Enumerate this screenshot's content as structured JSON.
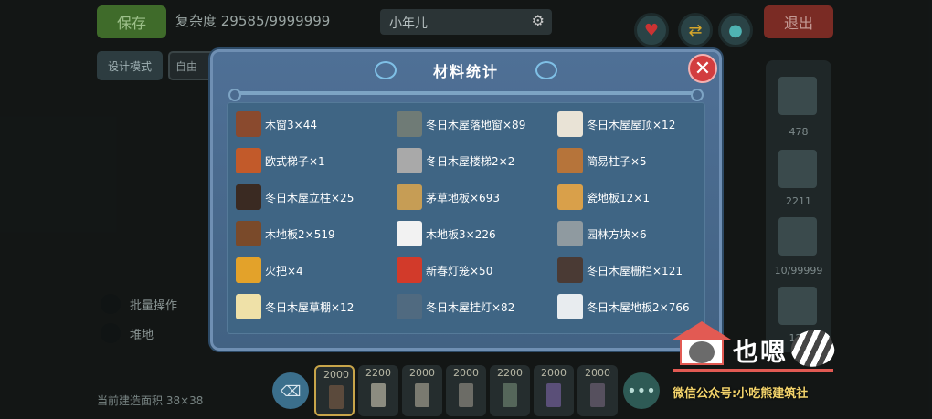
{
  "hud": {
    "save_label": "保存",
    "complexity": "复杂度 29585/9999999",
    "build_name": "小年儿",
    "exit_label": "退出",
    "design_mode": "设计模式",
    "free_cam": "自由",
    "batch_label": "批量操作",
    "flat_label": "堆地",
    "area_label": "当前建造面积 38×38",
    "side_counts": [
      "478",
      "2211",
      "10/99999",
      "121"
    ],
    "hotbar_costs": [
      "2000",
      "2200",
      "2000",
      "2000",
      "2200",
      "2000",
      "2000"
    ]
  },
  "dialog": {
    "title": "材料统计",
    "close_icon": "close-icon",
    "items": [
      {
        "label": "木窗3×44",
        "icon": "window-icon",
        "color": "#8a4a2e"
      },
      {
        "label": "冬日木屋落地窗×89",
        "icon": "floor-window-icon",
        "color": "#6f7b76"
      },
      {
        "label": "冬日木屋屋顶×12",
        "icon": "roof-icon",
        "color": "#e9e3d6"
      },
      {
        "label": "欧式梯子×1",
        "icon": "ladder-icon",
        "color": "#c25a2a"
      },
      {
        "label": "冬日木屋楼梯2×2",
        "icon": "stairs-icon",
        "color": "#a9a9a9"
      },
      {
        "label": "简易柱子×5",
        "icon": "pillar-icon",
        "color": "#b6743a"
      },
      {
        "label": "冬日木屋立柱×25",
        "icon": "post-icon",
        "color": "#3a2a22"
      },
      {
        "label": "茅草地板×693",
        "icon": "thatch-floor-icon",
        "color": "#c69d55"
      },
      {
        "label": "瓷地板12×1",
        "icon": "tile-floor-icon",
        "color": "#d9a04a"
      },
      {
        "label": "木地板2×519",
        "icon": "wood-floor-icon",
        "color": "#7a4a2a"
      },
      {
        "label": "木地板3×226",
        "icon": "white-floor-icon",
        "color": "#f2f2f2"
      },
      {
        "label": "园林方块×6",
        "icon": "garden-block-icon",
        "color": "#8f9aa0"
      },
      {
        "label": "火把×4",
        "icon": "torch-icon",
        "color": "#e3a22a"
      },
      {
        "label": "新春灯笼×50",
        "icon": "lantern-icon",
        "color": "#d23a2a"
      },
      {
        "label": "冬日木屋栅栏×121",
        "icon": "fence-icon",
        "color": "#4a3a34"
      },
      {
        "label": "冬日木屋草棚×12",
        "icon": "shed-icon",
        "color": "#efe1a8"
      },
      {
        "label": "冬日木屋挂灯×82",
        "icon": "string-lights-icon",
        "color": "#506a80"
      },
      {
        "label": "冬日木屋地板2×766",
        "icon": "floor-tile-icon",
        "color": "#e8ecef"
      }
    ]
  },
  "watermark": {
    "big": "也嗯",
    "sub": "微信公众号:小吃熊建筑社"
  }
}
